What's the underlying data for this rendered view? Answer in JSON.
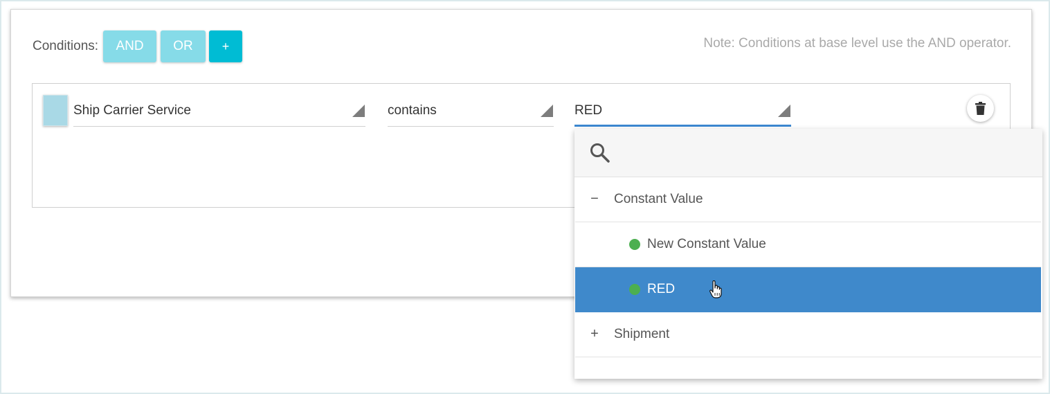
{
  "conditions": {
    "label": "Conditions:",
    "buttons": {
      "and_label": "AND",
      "or_label": "OR",
      "add_label": "+"
    },
    "note": "Note: Conditions at base level use the AND operator."
  },
  "rule": {
    "field": "Ship Carrier Service",
    "operator": "contains",
    "value": "RED"
  },
  "dropdown": {
    "search_placeholder": "",
    "groups": [
      {
        "toggle": "−",
        "label": "Constant Value",
        "expanded": true,
        "items": [
          {
            "label": "New Constant Value",
            "selected": false
          },
          {
            "label": "RED",
            "selected": true
          }
        ]
      },
      {
        "toggle": "+",
        "label": "Shipment",
        "expanded": false,
        "items": []
      }
    ]
  },
  "icons": {
    "delete": "trash-icon",
    "search": "search-icon",
    "cursor": "hand-pointer-icon"
  },
  "colors": {
    "logic_button": "#86dbe8",
    "add_button": "#00bcd4",
    "selected_row": "#3f89cb",
    "active_underline": "#3c88d1",
    "status_dot": "#4caf50",
    "checkbox": "#a9d9e6"
  }
}
